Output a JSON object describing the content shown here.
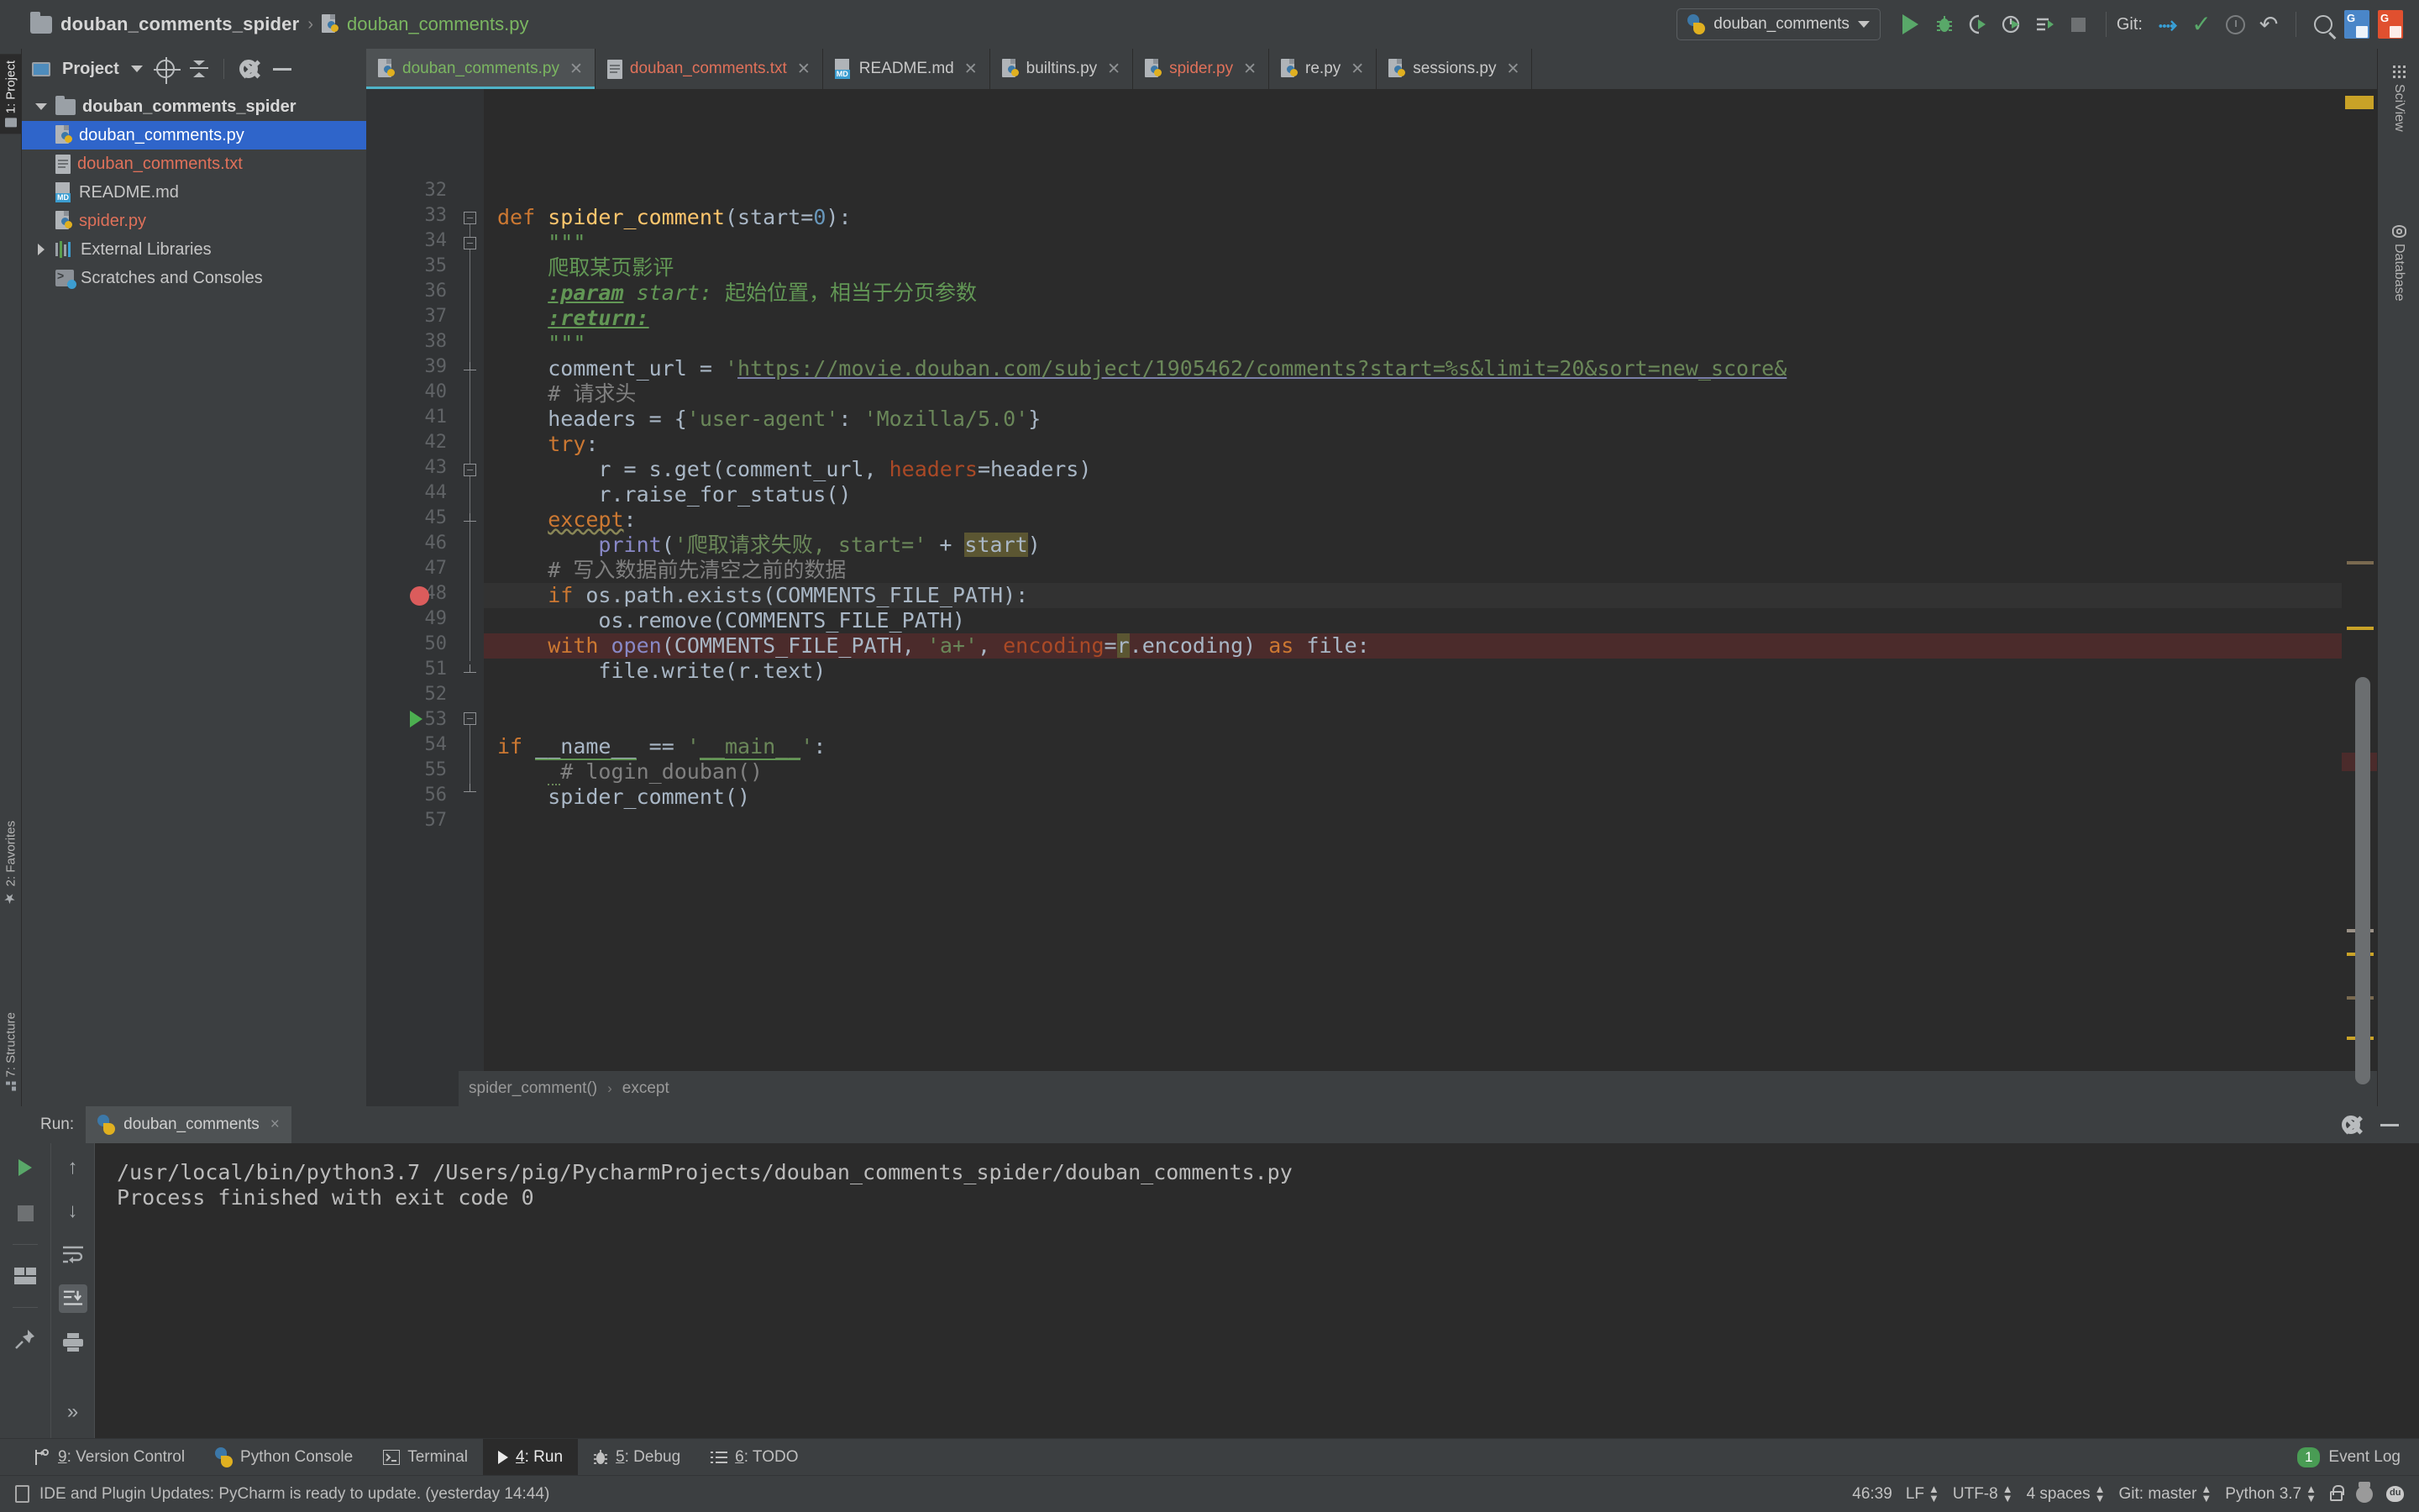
{
  "titlebar": {
    "breadcrumb": {
      "project": "douban_comments_spider",
      "separator": "›",
      "file": "douban_comments.py"
    },
    "run_config": {
      "name": "douban_comments"
    },
    "git_label": "Git:",
    "buttons": {
      "run": "Run",
      "debug": "Debug",
      "run_coverage": "Run with Coverage",
      "profile": "Profile",
      "run_tests": "Run Tests",
      "stop": "Stop",
      "update_project": "Update Project",
      "commit": "Commit",
      "history": "History",
      "rollback": "Rollback",
      "search_everywhere": "Search Everywhere",
      "translate_blue": "Translate",
      "translate_red": "Translate"
    }
  },
  "left_rail": {
    "project_tab": "1: Project",
    "favorites_tab": "2: Favorites",
    "structure_tab": "7: Structure"
  },
  "right_rail": {
    "sciview_tab": "SciView",
    "database_tab": "Database"
  },
  "project_panel": {
    "title": "Project",
    "actions": {
      "locate": "Select Opened File",
      "collapse": "Collapse All",
      "settings": "Settings",
      "hide": "Hide"
    },
    "tree": [
      {
        "label": "douban_comments_spider",
        "kind": "folder",
        "indent": 0,
        "expanded": true,
        "selected": false,
        "color": "bold"
      },
      {
        "label": "douban_comments.py",
        "kind": "python",
        "indent": 1,
        "selected": true,
        "color": "white"
      },
      {
        "label": "douban_comments.txt",
        "kind": "text",
        "indent": 1,
        "selected": false,
        "color": "red"
      },
      {
        "label": "README.md",
        "kind": "markdown",
        "indent": 1,
        "selected": false,
        "color": "grey"
      },
      {
        "label": "spider.py",
        "kind": "python",
        "indent": 1,
        "selected": false,
        "color": "red"
      },
      {
        "label": "External Libraries",
        "kind": "library",
        "indent": 0,
        "expanded": false,
        "selected": false,
        "color": "grey"
      },
      {
        "label": "Scratches and Consoles",
        "kind": "scratch",
        "indent": 0,
        "selected": false,
        "color": "grey"
      }
    ]
  },
  "editor_tabs": [
    {
      "label": "douban_comments.py",
      "icon": "python",
      "color": "green",
      "active": true
    },
    {
      "label": "douban_comments.txt",
      "icon": "text",
      "color": "red",
      "active": false
    },
    {
      "label": "README.md",
      "icon": "markdown",
      "color": "grey",
      "active": false
    },
    {
      "label": "builtins.py",
      "icon": "python",
      "color": "grey",
      "active": false
    },
    {
      "label": "spider.py",
      "icon": "python",
      "color": "red",
      "active": false
    },
    {
      "label": "re.py",
      "icon": "python",
      "color": "grey",
      "active": false
    },
    {
      "label": "sessions.py",
      "icon": "python",
      "color": "grey",
      "active": false
    }
  ],
  "editor": {
    "first_line_number": 32,
    "last_line_number": 57,
    "breakpoint_line": 48,
    "run_marker_line": 54,
    "current_line": 46,
    "code_lines": [
      {
        "n": 32,
        "text": ""
      },
      {
        "n": 33,
        "text": "def spider_comment(start=0):"
      },
      {
        "n": 34,
        "text": "    \"\"\""
      },
      {
        "n": 35,
        "text": "    爬取某页影评"
      },
      {
        "n": 36,
        "text": "    :param start: 起始位置，相当于分页参数"
      },
      {
        "n": 37,
        "text": "    :return:"
      },
      {
        "n": 38,
        "text": "    \"\"\""
      },
      {
        "n": 39,
        "text": "    comment_url = 'https://movie.douban.com/subject/1905462/comments?start=%s&limit=20&sort=new_score&"
      },
      {
        "n": 40,
        "text": "    # 请求头"
      },
      {
        "n": 41,
        "text": "    headers = {'user-agent': 'Mozilla/5.0'}"
      },
      {
        "n": 42,
        "text": "    try:"
      },
      {
        "n": 43,
        "text": "        r = s.get(comment_url, headers=headers)"
      },
      {
        "n": 44,
        "text": "        r.raise_for_status()"
      },
      {
        "n": 45,
        "text": "    except:"
      },
      {
        "n": 46,
        "text": "        print('爬取请求失败, start=' + start)"
      },
      {
        "n": 47,
        "text": "    # 写入数据前先清空之前的数据"
      },
      {
        "n": 48,
        "text": "    if os.path.exists(COMMENTS_FILE_PATH):"
      },
      {
        "n": 49,
        "text": "        os.remove(COMMENTS_FILE_PATH)"
      },
      {
        "n": 50,
        "text": "    with open(COMMENTS_FILE_PATH, 'a+', encoding=r.encoding) as file:"
      },
      {
        "n": 51,
        "text": "        file.write(r.text)"
      },
      {
        "n": 52,
        "text": ""
      },
      {
        "n": 53,
        "text": ""
      },
      {
        "n": 54,
        "text": "if __name__ == '__main__':"
      },
      {
        "n": 55,
        "text": "    # login_douban()"
      },
      {
        "n": 56,
        "text": "    spider_comment()"
      },
      {
        "n": 57,
        "text": ""
      }
    ]
  },
  "breadcrumb_strip": {
    "func": "spider_comment()",
    "sep": "›",
    "block": "except"
  },
  "run_panel": {
    "run_label": "Run:",
    "tab_name": "douban_comments",
    "close_label": "×",
    "settings_label": "Settings",
    "minimize_label": "Hide",
    "tools": [
      "rerun-button",
      "stop-button",
      "layout-button",
      "pin-button",
      "up-button",
      "down-button",
      "soft-wrap-button",
      "scroll-to-end-button",
      "print-button",
      "more-button"
    ],
    "console_lines": [
      "/usr/local/bin/python3.7 /Users/pig/PycharmProjects/douban_comments_spider/douban_comments.py",
      "",
      "Process finished with exit code 0"
    ]
  },
  "tool_windows": [
    {
      "num": "9",
      "label": ": Version Control",
      "icon": "vcs-icon",
      "active": false
    },
    {
      "num": "",
      "label": "Python Console",
      "icon": "python-icon",
      "active": false
    },
    {
      "num": "",
      "label": "Terminal",
      "icon": "terminal-icon",
      "active": false
    },
    {
      "num": "4",
      "label": ": Run",
      "icon": "run-icon",
      "active": true
    },
    {
      "num": "5",
      "label": ": Debug",
      "icon": "debug-icon",
      "active": false
    },
    {
      "num": "6",
      "label": ": TODO",
      "icon": "todo-icon",
      "active": false
    }
  ],
  "event_log": {
    "count": "1",
    "label": "Event Log"
  },
  "statusbar": {
    "message": "IDE and Plugin Updates: PyCharm is ready to update. (yesterday 14:44)",
    "caret": "46:39",
    "line_sep": "LF",
    "encoding": "UTF-8",
    "indent": "4 spaces",
    "branch": "Git: master",
    "interpreter": "Python 3.7"
  },
  "colors": {
    "accent_blue": "#2f65ca",
    "tab_underline": "#4fb3c8",
    "keyword": "#cc7832",
    "string": "#6a8759",
    "docstring": "#629755",
    "comment": "#808080",
    "function": "#ffc66d",
    "number": "#6897bb",
    "breakpoint": "#db5c5c",
    "error_line": "#4b2b2b",
    "editor_bg": "#2b2b2b",
    "chrome_bg": "#3c3f41"
  }
}
